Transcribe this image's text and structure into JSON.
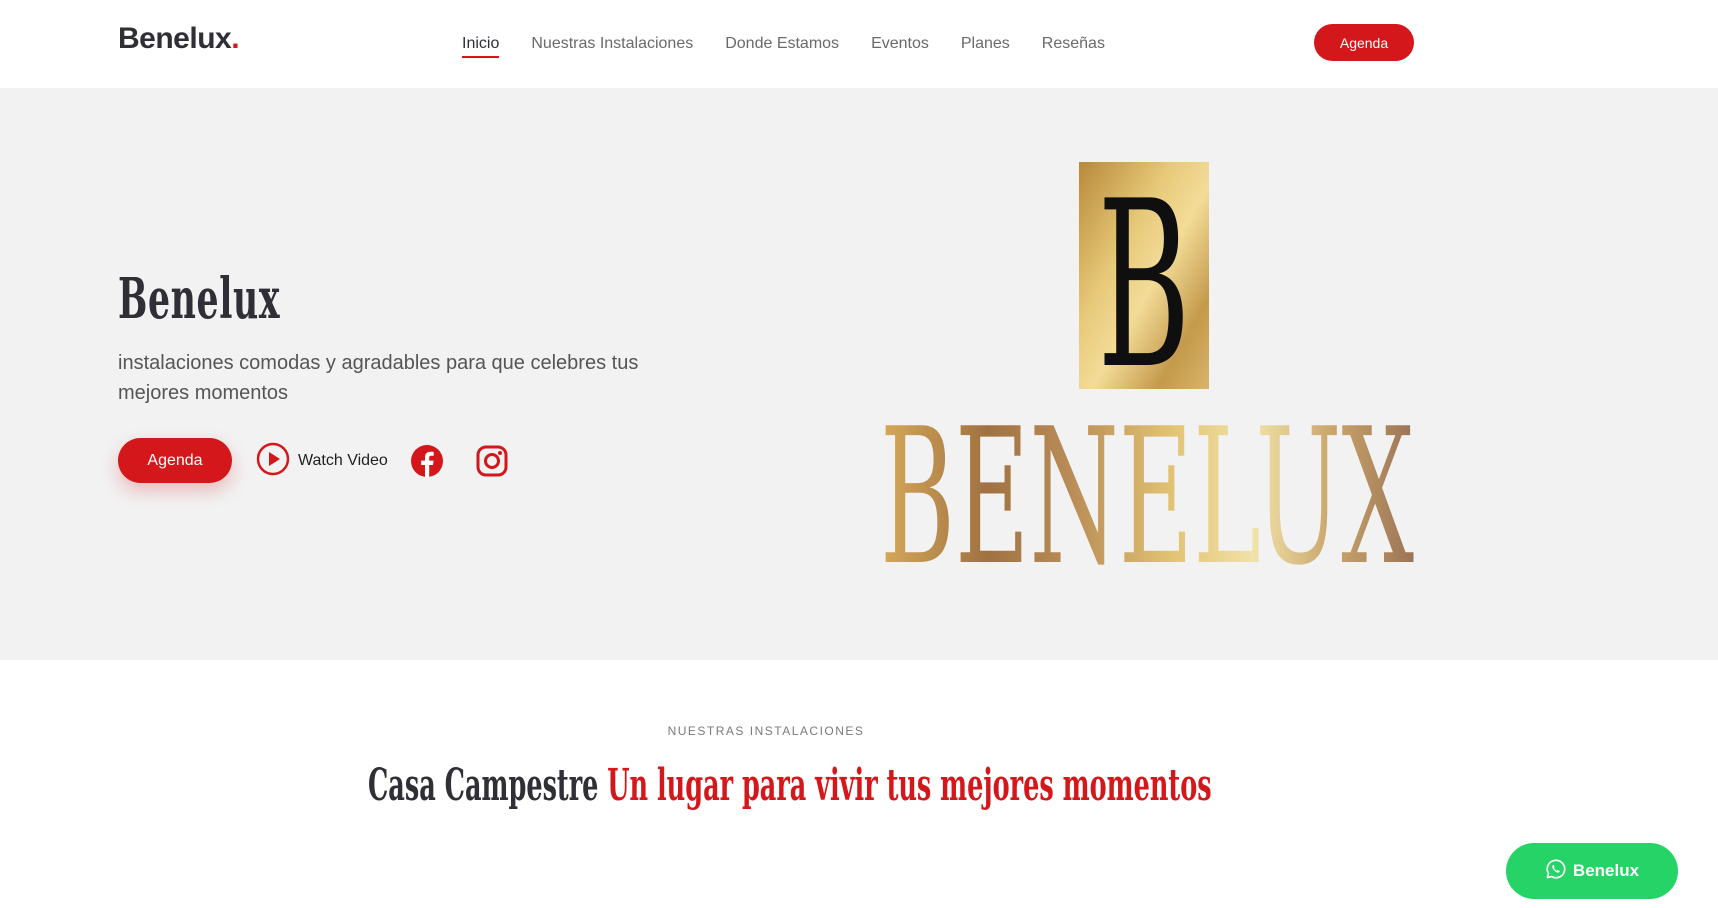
{
  "header": {
    "logo_text": "Benelux",
    "logo_dot": ".",
    "nav": [
      {
        "label": "Inicio",
        "active": true
      },
      {
        "label": "Nuestras Instalaciones"
      },
      {
        "label": "Donde Estamos"
      },
      {
        "label": "Eventos"
      },
      {
        "label": "Planes"
      },
      {
        "label": "Reseñas"
      }
    ],
    "cta_label": "Agenda"
  },
  "hero": {
    "title": "Benelux",
    "description": "instalaciones comodas y agradables para que celebres tus mejores momentos",
    "cta_label": "Agenda",
    "watch_label": "Watch Video",
    "social_icons": [
      "facebook-icon",
      "instagram-icon"
    ],
    "brand_art": {
      "monogram": "B",
      "wordmark": "BENELUX"
    }
  },
  "section": {
    "kicker": "NUESTRAS INSTALACIONES",
    "heading_dark": "Casa Campestre",
    "heading_red": "Un lugar para vivir tus mejores momentos"
  },
  "whatsapp": {
    "label": "Benelux",
    "icon": "whatsapp-icon"
  },
  "colors": {
    "accent": "#d3171b",
    "hero_bg": "#f2f2f2",
    "whatsapp": "#25d366",
    "gold": "#c9a24e"
  }
}
